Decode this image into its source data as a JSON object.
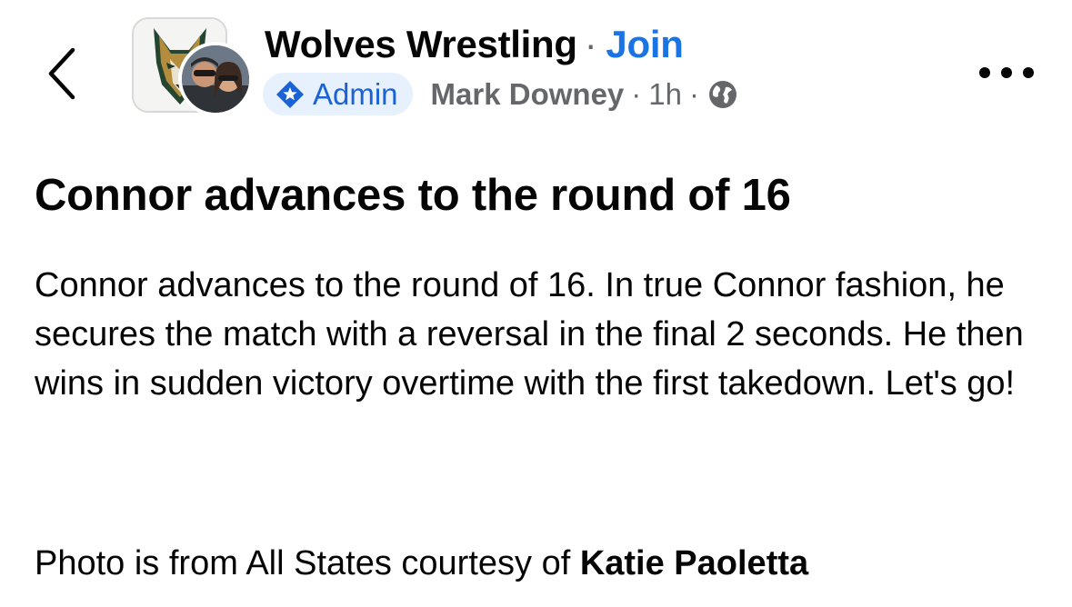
{
  "header": {
    "group_name": "Wolves Wrestling",
    "separator": "·",
    "join_label": "Join",
    "admin_badge": "Admin",
    "author": "Mark Downey",
    "time": "1h",
    "dot": "·",
    "icons": {
      "back": "chevron-left-icon",
      "admin": "star-diamond-icon",
      "privacy": "globe-icon",
      "more": "more-horizontal-icon"
    }
  },
  "post": {
    "title": "Connor advances to the round of 16",
    "body": "Connor advances to the round of 16. In true Connor fashion, he secures the match with a reversal in the final 2 seconds. He then wins in sudden victory overtime with the first takedown. Let's go!",
    "credit_prefix": "Photo is from All States courtesy of",
    "credit_name": "Katie Paoletta"
  },
  "colors": {
    "accent": "#1b74e4",
    "badge_bg": "#e7f0fd",
    "secondary_text": "#65676b"
  }
}
